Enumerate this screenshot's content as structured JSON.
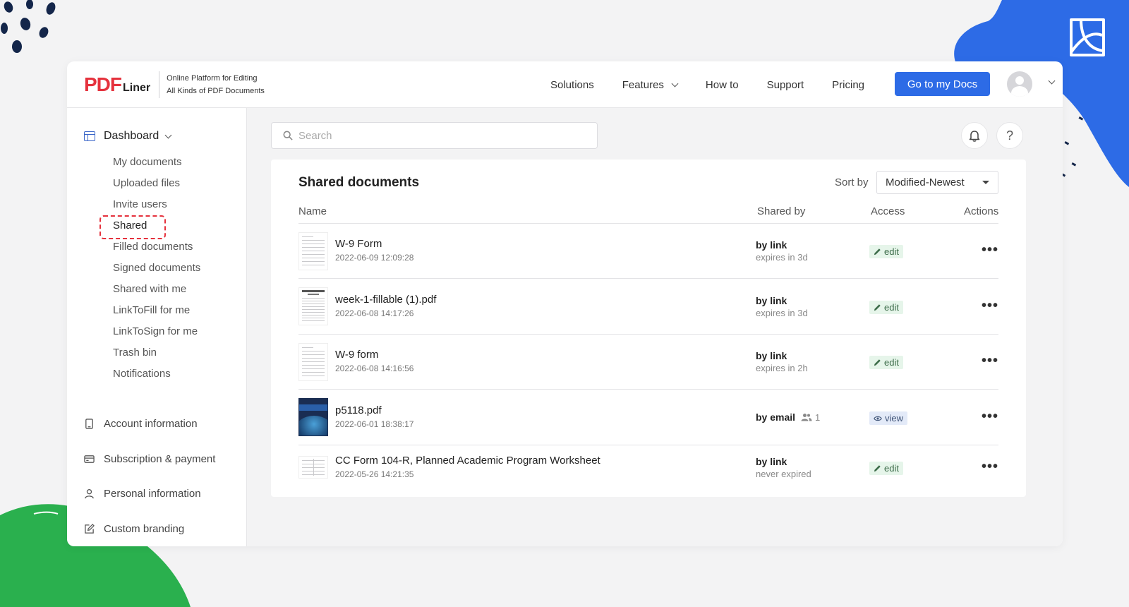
{
  "header": {
    "logo_pdf": "PDF",
    "logo_liner": "Liner",
    "tagline_1": "Online Platform for Editing",
    "tagline_2": "All Kinds of PDF Documents",
    "nav": [
      "Solutions",
      "Features",
      "How to",
      "Support",
      "Pricing"
    ],
    "cta": "Go to my Docs"
  },
  "sidebar": {
    "dashboard": "Dashboard",
    "items": [
      "My documents",
      "Uploaded files",
      "Invite users",
      "Shared",
      "Filled documents",
      "Signed documents",
      "Shared with me",
      "LinkToFill for me",
      "LinkToSign for me",
      "Trash bin",
      "Notifications"
    ],
    "active_item": "Shared",
    "links": [
      "Account information",
      "Subscription & payment",
      "Personal information",
      "Custom branding"
    ]
  },
  "search": {
    "placeholder": "Search"
  },
  "panel": {
    "title": "Shared documents",
    "sort_label": "Sort by",
    "sort_value": "Modified-Newest",
    "columns": {
      "name": "Name",
      "shared_by": "Shared by",
      "access": "Access",
      "actions": "Actions"
    },
    "rows": [
      {
        "name": "W-9 Form",
        "date": "2022-06-09 12:09:28",
        "shared_by": "by link",
        "shared_sub": "expires in 3d",
        "access": "edit"
      },
      {
        "name": "week-1-fillable (1).pdf",
        "date": "2022-06-08 14:17:26",
        "shared_by": "by link",
        "shared_sub": "expires in 3d",
        "access": "edit"
      },
      {
        "name": "W-9 form",
        "date": "2022-06-08 14:16:56",
        "shared_by": "by link",
        "shared_sub": "expires in 2h",
        "access": "edit"
      },
      {
        "name": "p5118.pdf",
        "date": "2022-06-01 18:38:17",
        "shared_by": "by email",
        "shared_count": "1",
        "access": "view"
      },
      {
        "name": "CC Form 104-R, Planned Academic Program Worksheet",
        "date": "2022-05-26 14:21:35",
        "shared_by": "by link",
        "shared_sub": "never expired",
        "access": "edit"
      }
    ],
    "actions_glyph": "•••"
  },
  "colors": {
    "brand_red": "#e5323d",
    "primary_blue": "#2d6be6",
    "edit_bg": "#e6f5ea",
    "view_bg": "#e3eaf8"
  }
}
